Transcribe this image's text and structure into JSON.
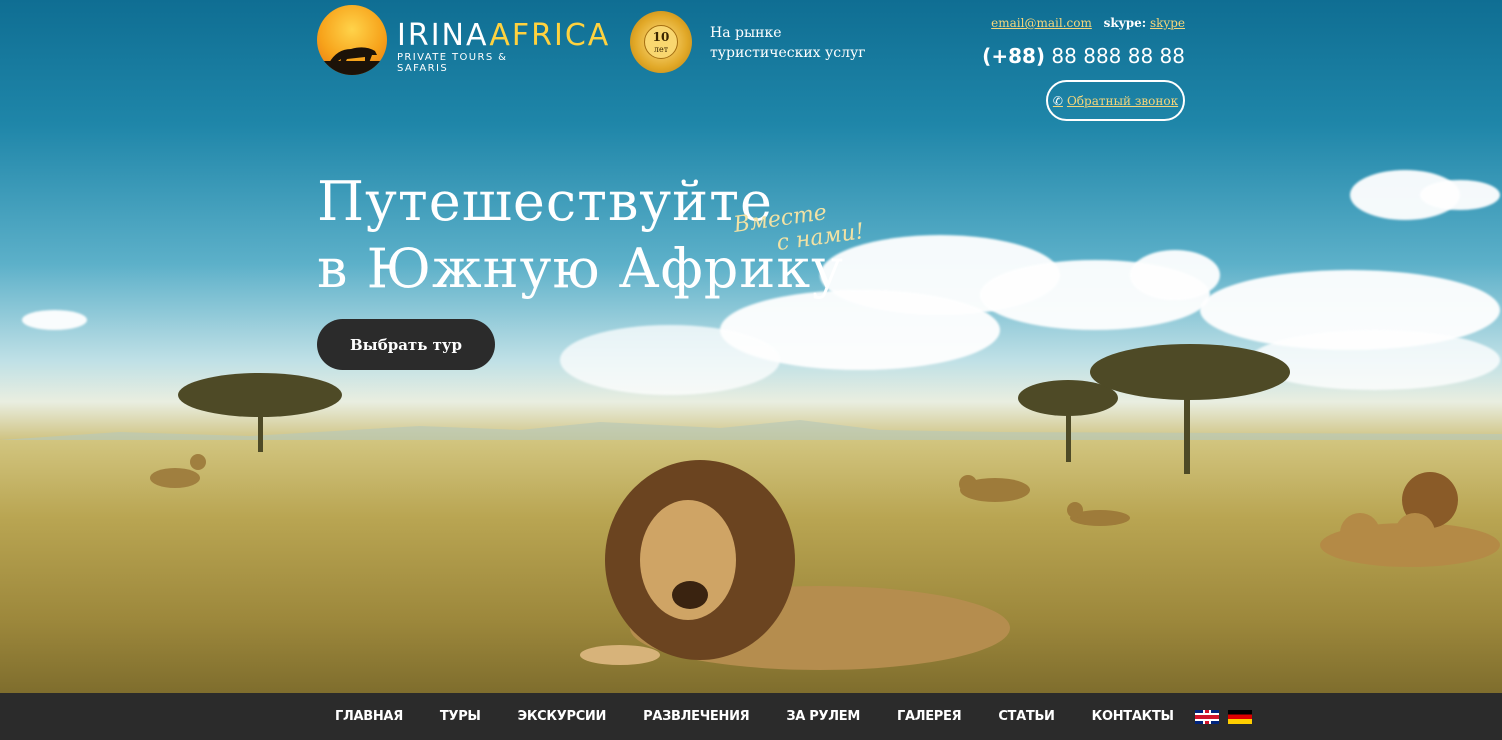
{
  "logo": {
    "brand_part1": "IRINA",
    "brand_part2": "AFRICA",
    "tagline": "PRIVATE TOURS & SAFARIS"
  },
  "badge": {
    "number": "10",
    "unit": "лет"
  },
  "market": {
    "line1": "На рынке",
    "line2": "туристических услуг"
  },
  "contacts": {
    "email": "email@mail.com",
    "skype_label": "skype:",
    "skype_value": "skype",
    "phone_code": "(+88)",
    "phone_number": "88 888 88 88",
    "callback_label": "Обратный звонок"
  },
  "hero": {
    "headline_line1": "Путешествуйте",
    "headline_line2": "в Южную Африку",
    "script_line1": "Вместе",
    "script_line2": "с нами!",
    "cta_label": "Выбрать тур"
  },
  "nav": {
    "items": [
      {
        "label": "Главная"
      },
      {
        "label": "Туры"
      },
      {
        "label": "Экскурсии"
      },
      {
        "label": "Развлечения"
      },
      {
        "label": "За рулем"
      },
      {
        "label": "Галерея"
      },
      {
        "label": "Статьи"
      },
      {
        "label": "Контакты"
      }
    ]
  },
  "colors": {
    "accent_gold": "#f6d67a",
    "nav_bg": "#2b2b2b",
    "sky": "#0f6e93"
  }
}
